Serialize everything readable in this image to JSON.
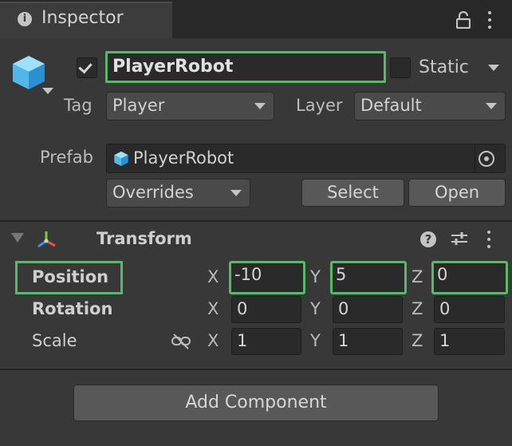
{
  "tab": {
    "title": "Inspector",
    "icon": "info-icon",
    "lock_icon": "lock-icon",
    "menu_icon": "kebab-menu-icon"
  },
  "header": {
    "object_icon": "cube-icon",
    "active": true,
    "name": "PlayerRobot",
    "static_checked": false,
    "static_label": "Static",
    "tag_label": "Tag",
    "tag_value": "Player",
    "layer_label": "Layer",
    "layer_value": "Default"
  },
  "prefab": {
    "label": "Prefab",
    "value": "PlayerRobot",
    "overrides_label": "Overrides",
    "select_label": "Select",
    "open_label": "Open"
  },
  "transform": {
    "title": "Transform",
    "icons": [
      "transform-icon",
      "help-icon",
      "presets-icon",
      "kebab-menu-icon"
    ],
    "position": {
      "label": "Position",
      "x_label": "X",
      "x": "-10",
      "y_label": "Y",
      "y": "5",
      "z_label": "Z",
      "z": "0"
    },
    "rotation": {
      "label": "Rotation",
      "x_label": "X",
      "x": "0",
      "y_label": "Y",
      "y": "0",
      "z_label": "Z",
      "z": "0"
    },
    "scale": {
      "label": "Scale",
      "x_label": "X",
      "x": "1",
      "y_label": "Y",
      "y": "1",
      "z_label": "Z",
      "z": "1"
    }
  },
  "add_component_label": "Add Component",
  "colors": {
    "highlight": "#57b96a",
    "panel": "#383838",
    "field": "#2a2a2a",
    "axis_x": "#e8533f",
    "axis_y": "#7ec83c",
    "axis_z": "#3d8ff0"
  }
}
